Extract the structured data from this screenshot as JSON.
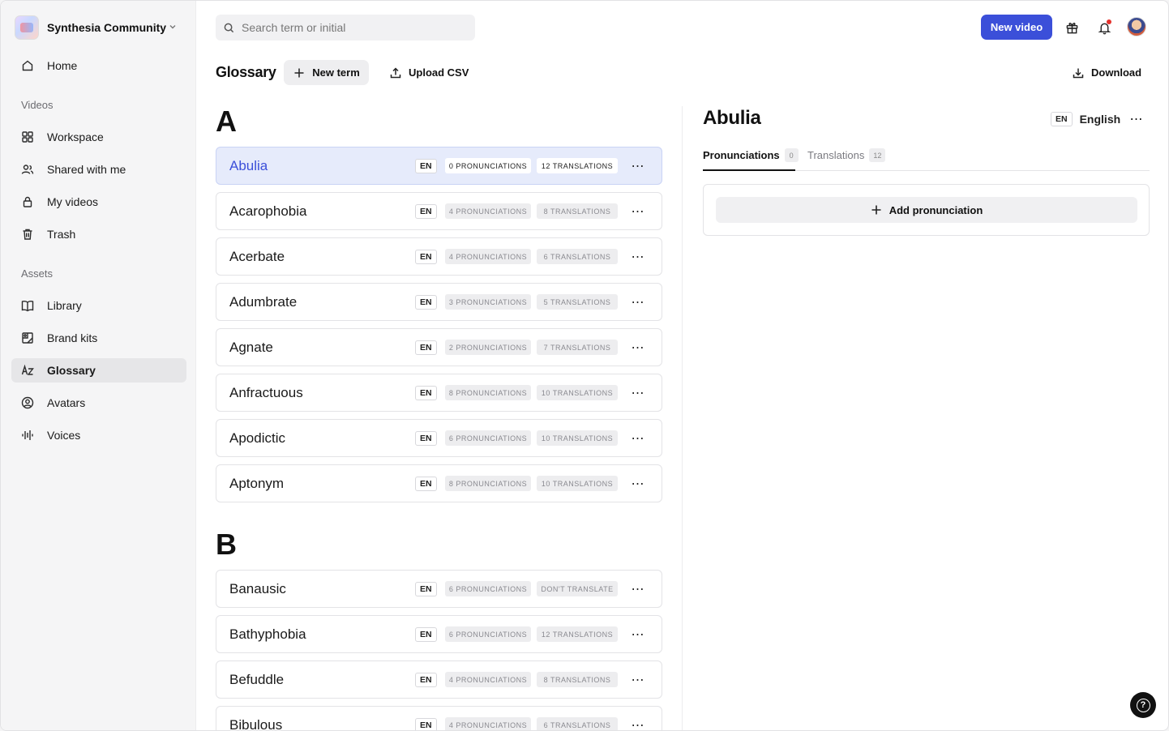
{
  "workspace": {
    "name": "Synthesia Community"
  },
  "sidebar": {
    "home": "Home",
    "sections": {
      "videos": "Videos",
      "assets": "Assets"
    },
    "videos_items": [
      {
        "label": "Workspace",
        "icon": "grid-icon"
      },
      {
        "label": "Shared with me",
        "icon": "users-icon"
      },
      {
        "label": "My videos",
        "icon": "lock-icon"
      },
      {
        "label": "Trash",
        "icon": "trash-icon"
      }
    ],
    "assets_items": [
      {
        "label": "Library",
        "icon": "book-icon"
      },
      {
        "label": "Brand kits",
        "icon": "brand-kit-icon"
      },
      {
        "label": "Glossary",
        "icon": "a-z-icon",
        "active": true
      },
      {
        "label": "Avatars",
        "icon": "avatar-icon"
      },
      {
        "label": "Voices",
        "icon": "waveform-icon"
      }
    ]
  },
  "topbar": {
    "search_placeholder": "Search term or initial",
    "new_video": "New video"
  },
  "glossary": {
    "title": "Glossary",
    "new_term": "New term",
    "upload_csv": "Upload CSV",
    "download": "Download"
  },
  "groups": [
    {
      "letter": "A",
      "terms": [
        {
          "name": "Abulia",
          "lang": "EN",
          "pronunciations": "0 PRONUNCIATIONS",
          "translations": "12 TRANSLATIONS",
          "selected": true
        },
        {
          "name": "Acarophobia",
          "lang": "EN",
          "pronunciations": "4 PRONUNCIATIONS",
          "translations": "8 TRANSLATIONS"
        },
        {
          "name": "Acerbate",
          "lang": "EN",
          "pronunciations": "4 PRONUNCIATIONS",
          "translations": "6 TRANSLATIONS"
        },
        {
          "name": "Adumbrate",
          "lang": "EN",
          "pronunciations": "3 PRONUNCIATIONS",
          "translations": "5 TRANSLATIONS"
        },
        {
          "name": "Agnate",
          "lang": "EN",
          "pronunciations": "2 PRONUNCIATIONS",
          "translations": "7 TRANSLATIONS"
        },
        {
          "name": "Anfractuous",
          "lang": "EN",
          "pronunciations": "8 PRONUNCIATIONS",
          "translations": "10 TRANSLATIONS"
        },
        {
          "name": "Apodictic",
          "lang": "EN",
          "pronunciations": "6 PRONUNCIATIONS",
          "translations": "10 TRANSLATIONS"
        },
        {
          "name": "Aptonym",
          "lang": "EN",
          "pronunciations": "8 PRONUNCIATIONS",
          "translations": "10 TRANSLATIONS"
        }
      ]
    },
    {
      "letter": "B",
      "terms": [
        {
          "name": "Banausic",
          "lang": "EN",
          "pronunciations": "6 PRONUNCIATIONS",
          "translations": "DON'T TRANSLATE"
        },
        {
          "name": "Bathyphobia",
          "lang": "EN",
          "pronunciations": "6 PRONUNCIATIONS",
          "translations": "12 TRANSLATIONS"
        },
        {
          "name": "Befuddle",
          "lang": "EN",
          "pronunciations": "4 PRONUNCIATIONS",
          "translations": "8 TRANSLATIONS"
        },
        {
          "name": "Bibulous",
          "lang": "EN",
          "pronunciations": "4 PRONUNCIATIONS",
          "translations": "6 TRANSLATIONS"
        }
      ]
    }
  ],
  "detail": {
    "title": "Abulia",
    "lang_code": "EN",
    "lang_name": "English",
    "tabs": [
      {
        "label": "Pronunciations",
        "count": "0",
        "active": true
      },
      {
        "label": "Translations",
        "count": "12"
      }
    ],
    "add_pronunciation": "Add pronunciation"
  },
  "colors": {
    "accent": "#3b4fd9",
    "selected_row": "#e6ebfb",
    "notification": "#e5322d"
  }
}
